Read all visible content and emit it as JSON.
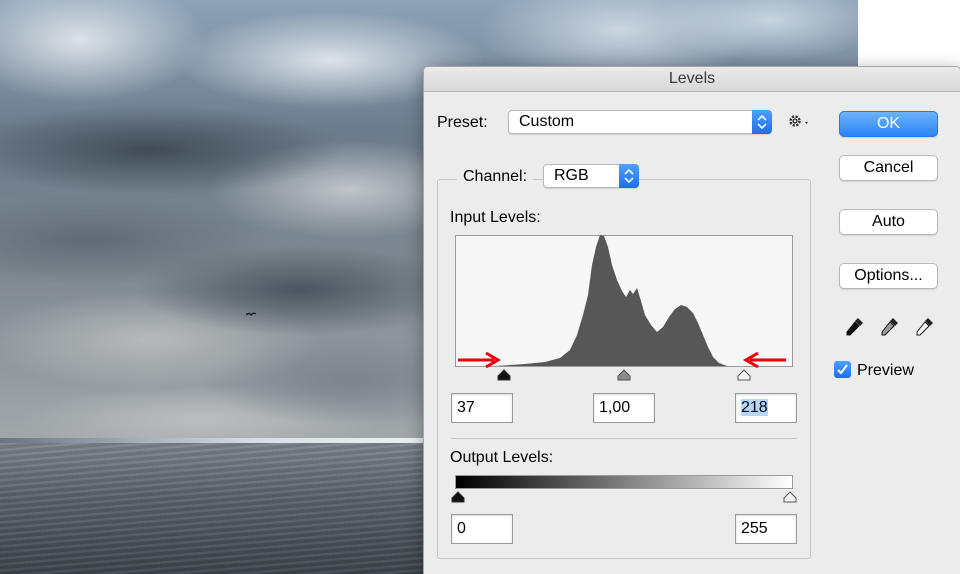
{
  "dialog": {
    "title": "Levels",
    "preset": {
      "label": "Preset:",
      "value": "Custom"
    },
    "channel": {
      "label": "Channel:",
      "value": "RGB"
    },
    "input_levels": {
      "label": "Input Levels:",
      "black": "37",
      "gamma": "1,00",
      "white": "218",
      "black_fraction": 0.145,
      "gamma_fraction": 0.5,
      "white_fraction": 0.855
    },
    "output_levels": {
      "label": "Output Levels:",
      "black": "0",
      "white": "255"
    },
    "buttons": {
      "ok": "OK",
      "cancel": "Cancel",
      "auto": "Auto",
      "options": "Options..."
    },
    "preview": {
      "label": "Preview",
      "checked": true
    },
    "icons": {
      "gear": "gear-icon",
      "eyedroppers": [
        "black-eyedropper-icon",
        "gray-eyedropper-icon",
        "white-eyedropper-icon"
      ]
    },
    "colors": {
      "accent": "#2c85f5",
      "histogram_fill": "#575757",
      "annotation_arrow": "#e8000a",
      "selection": "#b3d7ff"
    }
  }
}
